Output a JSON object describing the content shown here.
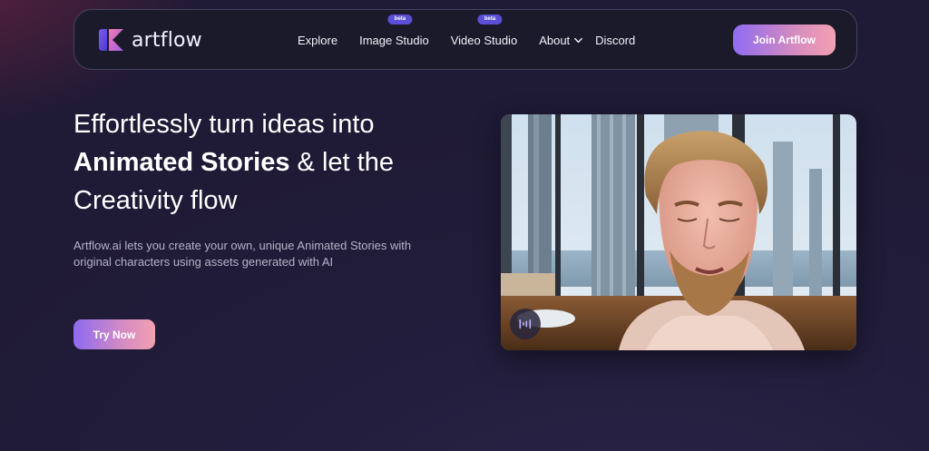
{
  "nav": {
    "logo_text": "artflow",
    "links": [
      {
        "label": "Explore",
        "badge": ""
      },
      {
        "label": "Image Studio",
        "badge": "beta"
      },
      {
        "label": "Video Studio",
        "badge": "beta"
      },
      {
        "label": "About",
        "badge": ""
      },
      {
        "label": "Discord",
        "badge": ""
      }
    ],
    "cta_label": "Join Artflow"
  },
  "hero": {
    "title_line1": "Effortlessly turn ideas into",
    "title_bold": "Animated Stories",
    "title_mid": " & let the",
    "title_line3": "Creativity flow",
    "description": "Artflow.ai lets you create your own, unique Animated Stories with original characters using assets generated with AI",
    "cta_label": "Try Now"
  },
  "video": {
    "control_icon": "audio-waveform-icon"
  },
  "colors": {
    "accent_start": "#8e6af0",
    "accent_end": "#f2a1b0",
    "badge": "#5b4fd6",
    "navbar_bg": "#1b1a2b",
    "page_bg": "#221c3c"
  }
}
